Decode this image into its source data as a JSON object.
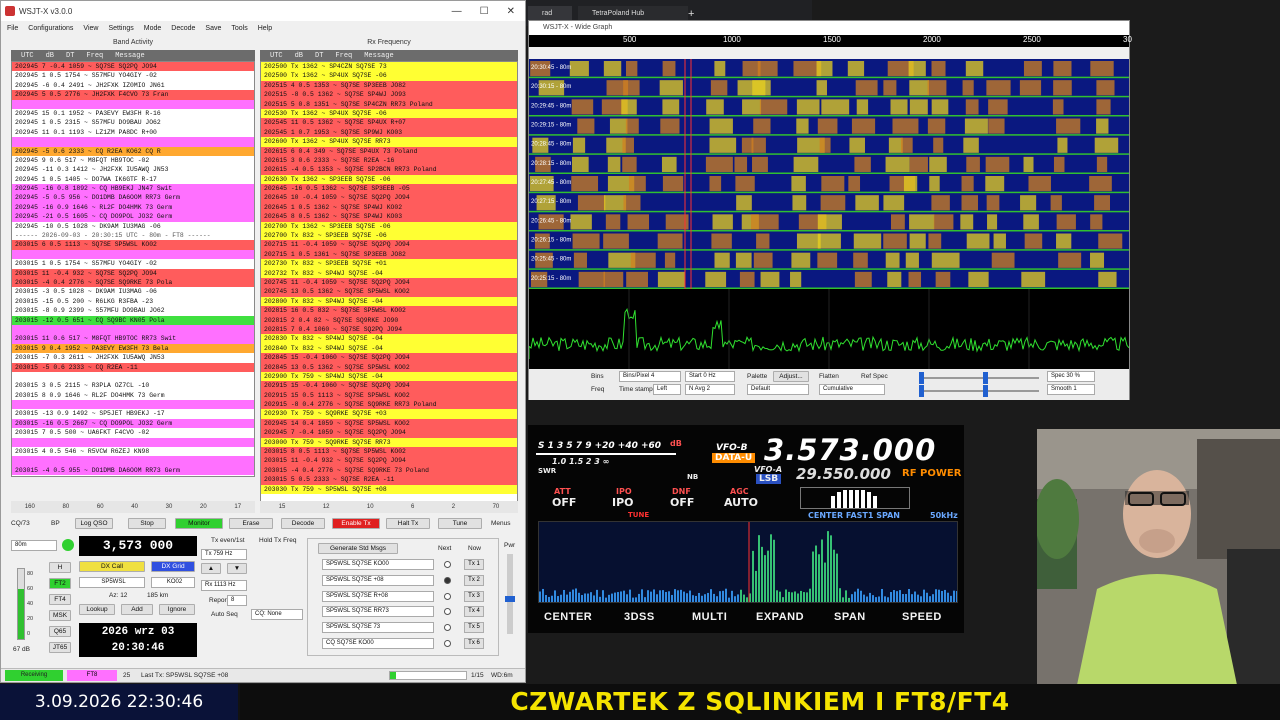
{
  "wsjt": {
    "title": "WSJT-X  v3.0.0",
    "window_controls": [
      "—",
      "☐",
      "✕"
    ],
    "menu": [
      "File",
      "Configurations",
      "View",
      "Settings",
      "Mode",
      "Decode",
      "Save",
      "Tools",
      "Help"
    ],
    "band_activity_title": "Band Activity",
    "rx_frequency_title": "Rx Frequency",
    "col_headers": [
      "UTC",
      "dB",
      "DT",
      "Freq",
      "Message"
    ],
    "band_rows": [
      {
        "t": "202945  7 -0.4 1059 ~  SQ7SE SQ2PQ JO94",
        "c": "red"
      },
      {
        "t": "202945  1  0.5 1754 ~  S57MFU YO4GIY -02",
        "c": "white"
      },
      {
        "t": "202945 -6  0.4 2491 ~  JH2FXK IZ0MIO JN61",
        "c": "white"
      },
      {
        "t": "202945  5  0.5 2776 ~  JH2FXK F4CVO 73     Fran",
        "c": "red"
      },
      {
        "t": "",
        "c": "pink"
      },
      {
        "t": "202945 15  0.1 1952 ~  PA3EVY EW3FH R-16",
        "c": "white"
      },
      {
        "t": "202945  1  0.5 2315 ~  S57MFU DO9BAU JO62",
        "c": "white"
      },
      {
        "t": "202945 11  0.1 1193 ~  LZ1ZM PA8DC R+00",
        "c": "white"
      },
      {
        "t": "",
        "c": "pink"
      },
      {
        "t": "202945 -5  0.6 2333 ~  CQ R2EA KO62          CQ R",
        "c": "orange"
      },
      {
        "t": "202945  9  0.6  517 ~  M8FQT HB9TOC -02",
        "c": "white"
      },
      {
        "t": "202945 -11  0.3 1412 ~  JH2FXK IU5AWQ JN53",
        "c": "white"
      },
      {
        "t": "202945  1  0.5 1405 ~  DO7WA IK6GTF R-17",
        "c": "white"
      },
      {
        "t": "202945 -16  0.8 1892 ~  CQ HB9EKJ JN47       Swit",
        "c": "pink"
      },
      {
        "t": "202945 -5  0.5  956 ~  DO1DMB DA6OOM RR73   Germ",
        "c": "pink"
      },
      {
        "t": "202945 -16  0.9 1646 ~  RL2F DO4HMK 73       Germ",
        "c": "pink"
      },
      {
        "t": "202945 -21  0.5 1605 ~  CQ DO9POL JO32       Germ",
        "c": "pink"
      },
      {
        "t": "202945 -10  0.5 1028 ~  DK9AM IU3MAG -06",
        "c": "white"
      },
      {
        "t": "------ 2026-09-03 - 20:30:15 UTC - 80m - FT8 ------",
        "c": "sep"
      },
      {
        "t": "203015  6  0.5 1113 ~  SQ7SE SP5WSL KO02",
        "c": "red"
      },
      {
        "t": "",
        "c": "pink"
      },
      {
        "t": "203015  1  0.5 1754 ~  S57MFU YO4GIY -02",
        "c": "white"
      },
      {
        "t": "203015 11 -0.4  932 ~  SQ7SE SQ2PQ JO94",
        "c": "red"
      },
      {
        "t": "203015 -4  0.4 2776 ~  SQ7SE SQ9RKE 73      Pola",
        "c": "red"
      },
      {
        "t": "203015 -3  0.5 1028 ~  DK9AM IU3MAG -06",
        "c": "white"
      },
      {
        "t": "203015 -15  0.5  200 ~  R6LKG R3FBA -23",
        "c": "white"
      },
      {
        "t": "203015 -8  0.9 2399 ~  S57MFU DO9BAU JO62",
        "c": "white"
      },
      {
        "t": "203015 -12  0.5  651 ~  CQ SQ9BC KN05        Pola",
        "c": "green"
      },
      {
        "t": "",
        "c": "pink"
      },
      {
        "t": "203015 11  0.6  517 ~  M8FQT HB9TOC RR73    Swit",
        "c": "pink"
      },
      {
        "t": "203015  9  0.4 1952 ~  PA3EVY EW3FH 73      Bela",
        "c": "orange"
      },
      {
        "t": "203015 -7  0.3 2611 ~  JH2FXK IU5AWQ JN53",
        "c": "white"
      },
      {
        "t": "203015 -5  0.6 2333 ~  CQ R2EA -11",
        "c": "red"
      },
      {
        "t": "",
        "c": "white"
      },
      {
        "t": "203015  3  0.5 2115 ~  R3PLA OZ7CL -10",
        "c": "white"
      },
      {
        "t": "203015  8  0.9 1646 ~  RL2F DO4HMK 73       Germ",
        "c": "white"
      },
      {
        "t": "",
        "c": "pink"
      },
      {
        "t": "203015 -13  0.9 1492 ~  SP5JET HB9EKJ -17",
        "c": "white"
      },
      {
        "t": "203015 -16  0.5 2667 ~  CQ DO9POL JO32       Germ",
        "c": "pink"
      },
      {
        "t": "203015  7  0.5  500 ~  UA6FKT F4CVO -02",
        "c": "white"
      },
      {
        "t": "",
        "c": "pink"
      },
      {
        "t": "203015  4  0.5  546 ~  R5VCW R6ZEJ KN98",
        "c": "white"
      },
      {
        "t": "",
        "c": "pink"
      },
      {
        "t": "203015 -4  0.5  955 ~  DO1DMB DA6OOM RR73   Germ",
        "c": "pink"
      }
    ],
    "rx_rows": [
      {
        "t": "202500  Tx       1362 ~  SP4CZN SQ7SE 73",
        "c": "yellow"
      },
      {
        "t": "202500  Tx       1362 ~  SP4UX SQ7SE -06",
        "c": "yellow"
      },
      {
        "t": "202515  4  0.5 1353 ~  SQ7SE SP3EEB JO82",
        "c": "red"
      },
      {
        "t": "202515 -8  0.5 1362 ~  SQ7SE SP4WJ JO93",
        "c": "red"
      },
      {
        "t": "202515  5  0.8 1351 ~  SQ7SE SP4CZN RR73    Poland",
        "c": "red"
      },
      {
        "t": "202530  Tx       1362 ~  SP4UX SQ7SE -06",
        "c": "yellow"
      },
      {
        "t": "202545 11  0.5 1362 ~  SQ7SE SP4UX R+07",
        "c": "red"
      },
      {
        "t": "202545  1  0.7 1953 ~  SQ7SE SP9WJ KO03",
        "c": "red"
      },
      {
        "t": "202600  Tx       1362 ~  SP4UX SQ7SE RR73",
        "c": "yellow"
      },
      {
        "t": "202615  6  0.4  349 ~  SQ7SE SP4UX 73       Poland",
        "c": "red"
      },
      {
        "t": "202615  3  0.6 2333 ~  SQ7SE R2EA -16",
        "c": "red"
      },
      {
        "t": "202615 -4  0.5 1353 ~  SQ7SE SP2BCN RR73    Poland",
        "c": "red"
      },
      {
        "t": "202630  Tx       1362 ~  SP3EEB SQ7SE -06",
        "c": "yellow"
      },
      {
        "t": "202645 -16  0.5 1362 ~  SQ7SE SP3EEB -05",
        "c": "red"
      },
      {
        "t": "202645 10 -0.4 1059 ~  SQ7SE SQ2PQ JO94",
        "c": "red"
      },
      {
        "t": "202645  1  0.5 1362 ~  SQ7SE SP4WJ KO02",
        "c": "red"
      },
      {
        "t": "202645  8  0.5 1362 ~  SQ7SE SP4WJ KO03",
        "c": "red"
      },
      {
        "t": "202700  Tx       1362 ~  SP3EEB SQ7SE -06",
        "c": "yellow"
      },
      {
        "t": "202700  Tx        832 ~  SP3EEB SQ7SE -06",
        "c": "yellow"
      },
      {
        "t": "202715 11 -0.4 1059 ~  SQ7SE SQ2PQ JO94",
        "c": "red"
      },
      {
        "t": "202715  1  0.5 1361 ~  SQ7SE SP3EEB JO82",
        "c": "red"
      },
      {
        "t": "202730  Tx        832 ~  SP3EEB SQ7SE +01",
        "c": "yellow"
      },
      {
        "t": "202732  Tx        832 ~  SP4WJ SQ7SE -04",
        "c": "yellow"
      },
      {
        "t": "202745 11 -0.4 1059 ~  SQ7SE SQ2PQ JO94",
        "c": "red"
      },
      {
        "t": "202745 13  0.5 1362 ~  SQ7SE SP5WSL KO02",
        "c": "red"
      },
      {
        "t": "202800  Tx        832 ~  SP4WJ SQ7SE -04",
        "c": "yellow"
      },
      {
        "t": "202815 16  0.5  832 ~  SQ7SE SP5WSL KO02",
        "c": "red"
      },
      {
        "t": "202815  2  0.4   82 ~  SQ7SE SQ9RKE JO90",
        "c": "red"
      },
      {
        "t": "202815  7  0.4 1060 ~  SQ7SE SQ2PQ JO94",
        "c": "red"
      },
      {
        "t": "202830  Tx        832 ~  SP4WJ SQ7SE -04",
        "c": "yellow"
      },
      {
        "t": "202840  Tx        832 ~  SP4WJ SQ7SE -04",
        "c": "yellow"
      },
      {
        "t": "202845 15 -0.4 1060 ~  SQ7SE SQ2PQ JO94",
        "c": "red"
      },
      {
        "t": "202845 13  0.5 1362 ~  SQ7SE SP5WSL KO02",
        "c": "red"
      },
      {
        "t": "202900  Tx        759 ~  SP4WJ SQ7SE -04",
        "c": "yellow"
      },
      {
        "t": "202915 15 -0.4 1060 ~  SQ7SE SQ2PQ JO94",
        "c": "red"
      },
      {
        "t": "202915 15  0.5 1113 ~  SQ7SE SP5WSL KO02",
        "c": "red"
      },
      {
        "t": "202915 -8  0.4 2776 ~  SQ7SE SQ9RKE RR73    Poland",
        "c": "red"
      },
      {
        "t": "202930  Tx        759 ~  SQ9RKE SQ7SE +03",
        "c": "yellow"
      },
      {
        "t": "202945 14  0.4 1059 ~  SQ7SE SP5WSL KO02",
        "c": "red"
      },
      {
        "t": "202945  7 -0.4 1059 ~  SQ7SE SQ2PQ JO94",
        "c": "red"
      },
      {
        "t": "203000  Tx        759 ~  SQ9RKE SQ7SE RR73",
        "c": "yellow"
      },
      {
        "t": "203015  8  0.5 1113 ~  SQ7SE SP5WSL KO02",
        "c": "red"
      },
      {
        "t": "203015 11 -0.4  932 ~  SQ7SE SQ2PQ JO94",
        "c": "red"
      },
      {
        "t": "203015 -4  0.4 2776 ~  SQ7SE SQ9RKE 73      Poland",
        "c": "red"
      },
      {
        "t": "203015  5  0.5 2333 ~  SQ7SE R2EA -11",
        "c": "red"
      },
      {
        "t": "203030  Tx        759 ~  SP5WSL SQ7SE +08",
        "c": "yellow"
      }
    ],
    "scale_left": [
      "160",
      "80",
      "60",
      "40",
      "30",
      "20",
      "17"
    ],
    "scale_right": [
      "15",
      "12",
      "10",
      "6",
      "2",
      "70"
    ],
    "controls": {
      "cq73": "CQ/73",
      "bp": "BP",
      "log_qso": "Log QSO",
      "stop": "Stop",
      "monitor": "Monitor",
      "erase": "Erase",
      "decode": "Decode",
      "enable_tx": "Enable Tx",
      "halt_tx": "Halt Tx",
      "tune": "Tune",
      "menus": "Menus",
      "band": "80m",
      "dial_freq": "3,573 000",
      "tx_even": "Tx even/1st",
      "hold_tx": "Hold Tx Freq",
      "tx_hz": "Tx  759 Hz",
      "rx_hz": "Rx  1113 Hz",
      "report": "Report",
      "report_val": "8",
      "auto_seq": "Auto Seq",
      "cq_none": "CQ: None",
      "dx_call_label": "DX Call",
      "dx_grid_label": "DX Grid",
      "dx_call": "SP5WSL",
      "dx_grid": "KO02",
      "az": "Az: 12",
      "dist": "185 km",
      "lookup": "Lookup",
      "add": "Add",
      "ignore": "Ignore",
      "date": "2026 wrz 03",
      "time": "20:30:46",
      "gen_std": "Generate Std Msgs",
      "next": "Next",
      "now": "Now",
      "pwr": "Pwr",
      "modes": [
        "H",
        "FT2",
        "FT4",
        "MSK",
        "Q65",
        "JT65"
      ],
      "level_ticks": [
        "80",
        "60",
        "40",
        "20",
        "0"
      ],
      "level_db": "67 dB"
    },
    "tx_msgs": [
      {
        "msg": "SP5WSL SQ7SE KO00",
        "btn": "Tx 1"
      },
      {
        "msg": "SP5WSL SQ7SE +08",
        "btn": "Tx 2"
      },
      {
        "msg": "SP5WSL SQ7SE R+08",
        "btn": "Tx 3"
      },
      {
        "msg": "SP5WSL SQ7SE RR73",
        "btn": "Tx 4"
      },
      {
        "msg": "SP5WSL SQ7SE 73",
        "btn": "Tx 5"
      },
      {
        "msg": "CQ SQ7SE KO00",
        "btn": "Tx 6"
      }
    ],
    "status": {
      "receiving": "Receiving",
      "mode": "FT8",
      "count": "25",
      "last_tx": "Last Tx: SP5WSL SQ7SE +08",
      "progress": "1/15",
      "wd": "WD:6m"
    }
  },
  "browser": {
    "tab1": "rad",
    "tab2": "TetraPoland Hub",
    "new_tab": "+"
  },
  "wide_graph": {
    "title": "WSJT-X - Wide Graph",
    "axis_labels": [
      "500",
      "1000",
      "1500",
      "2000",
      "2500",
      "30"
    ],
    "row_labels": [
      "20:30:45 - 80m",
      "20:30:15 - 80m",
      "20:29:45 - 80m",
      "20:29:15 - 80m",
      "20:28:45 - 80m",
      "20:28:15 - 80m",
      "20:27:45 - 80m",
      "20:27:15 - 80m",
      "20:26:45 - 80m",
      "20:26:15 - 80m",
      "20:25:45 - 80m",
      "20:25:15 - 80m"
    ],
    "controls": {
      "bins": "Bins",
      "bins_val": "Bins/Pixel  4",
      "start": "Start  0 Hz",
      "palette": "Palette",
      "adjust": "Adjust...",
      "default": "Default",
      "flatten": "Flatten",
      "ref_spec": "Ref Spec",
      "freq": "Freq",
      "time_stamp": "Time stamp",
      "left": "Left",
      "navg": "N Avg  2",
      "cumulative": "Cumulative",
      "spec": "Spec 30 %",
      "smooth": "Smooth  1"
    }
  },
  "radio": {
    "s_scale": "S  1  3  5  7  9  +20 +40 +60",
    "s_db": "dB",
    "swr_scale": "1.0  1.5  2  3     ∞",
    "swr": "SWR",
    "nb": "NB",
    "vfo_b": "VFO-B",
    "data_u": "DATA-U",
    "freq_main": "3.573.000",
    "vfo_a": "VFO-A",
    "lsb": "LSB",
    "freq_sub": "29.550.000",
    "rf_power": "RF POWER",
    "att": "ATT",
    "att_val": "OFF",
    "ipo": "IPO",
    "ipo_val": "IPO",
    "dnf": "DNF",
    "dnf_val": "OFF",
    "agc": "AGC",
    "agc_val": "AUTO",
    "tune": "TUNE",
    "center_fast": "CENTER  FAST1  SPAN",
    "span_val": "50kHz",
    "softkeys": [
      "CENTER",
      "3DSS",
      "MULTI",
      "EXPAND",
      "SPAN",
      "SPEED"
    ]
  },
  "clock": "3.09.2026 22:30:46",
  "banner": "CZWARTEK Z SQLINKIEM I FT8/FT4",
  "colors": {
    "red": "#ff5c5c",
    "pink": "#ff70ff",
    "yellow": "#ffff33",
    "green": "#40e040",
    "orange": "#ffa830",
    "banner_text": "#f5e400",
    "radio_freq": "#ffffff",
    "radio_accent": "#ff8c00"
  }
}
